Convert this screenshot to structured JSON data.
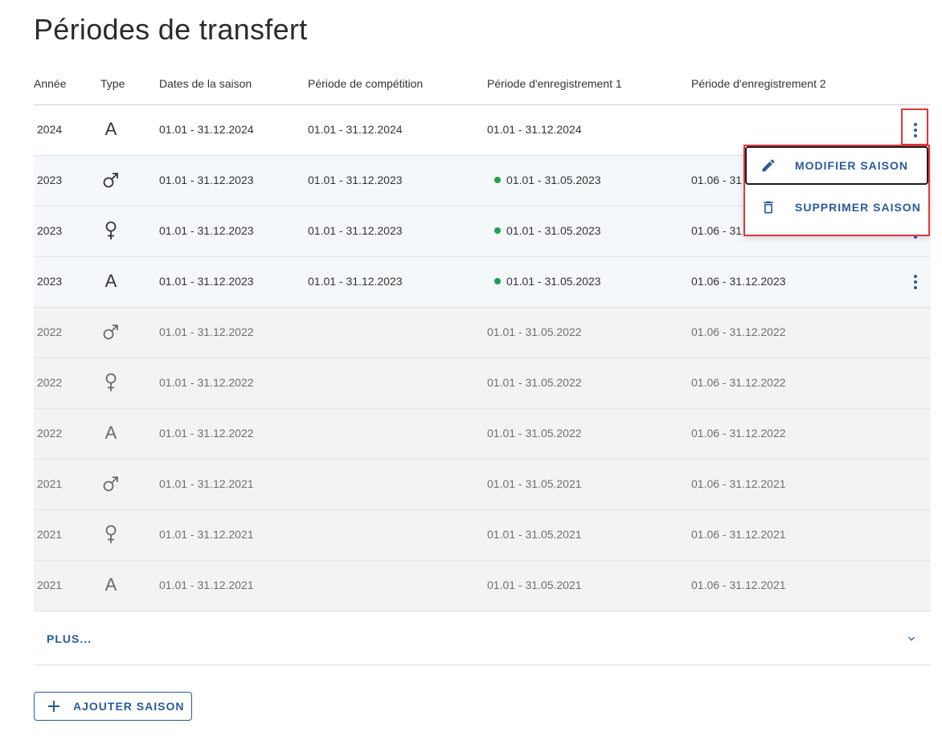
{
  "page": {
    "title": "Périodes de transfert"
  },
  "table": {
    "headers": {
      "year": "Année",
      "type": "Type",
      "season_dates": "Dates de la saison",
      "competition_period": "Période de compétition",
      "registration_period_1": "Période d'enregistrement 1",
      "registration_period_2": "Période d'enregistrement 2"
    },
    "rows": [
      {
        "year": "2024",
        "type": "A",
        "season_dates": "01.01 - 31.12.2024",
        "competition_period": "01.01 - 31.12.2024",
        "registration_period_1": "01.01 - 31.12.2024",
        "registration_period_2": ""
      },
      {
        "year": "2023",
        "type": "male",
        "season_dates": "01.01 - 31.12.2023",
        "competition_period": "01.01 - 31.12.2023",
        "registration_period_1": "01.01 - 31.05.2023",
        "registration_period_2": "01.06 - 31"
      },
      {
        "year": "2023",
        "type": "female",
        "season_dates": "01.01 - 31.12.2023",
        "competition_period": "01.01 - 31.12.2023",
        "registration_period_1": "01.01 - 31.05.2023",
        "registration_period_2": "01.06 - 31"
      },
      {
        "year": "2023",
        "type": "A",
        "season_dates": "01.01 - 31.12.2023",
        "competition_period": "01.01 - 31.12.2023",
        "registration_period_1": "01.01 - 31.05.2023",
        "registration_period_2": "01.06 - 31.12.2023"
      },
      {
        "year": "2022",
        "type": "male",
        "season_dates": "01.01 - 31.12.2022",
        "competition_period": "",
        "registration_period_1": "01.01 - 31.05.2022",
        "registration_period_2": "01.06 - 31.12.2022"
      },
      {
        "year": "2022",
        "type": "female",
        "season_dates": "01.01 - 31.12.2022",
        "competition_period": "",
        "registration_period_1": "01.01 - 31.05.2022",
        "registration_period_2": "01.06 - 31.12.2022"
      },
      {
        "year": "2022",
        "type": "A",
        "season_dates": "01.01 - 31.12.2022",
        "competition_period": "",
        "registration_period_1": "01.01 - 31.05.2022",
        "registration_period_2": "01.06 - 31.12.2022"
      },
      {
        "year": "2021",
        "type": "male",
        "season_dates": "01.01 - 31.12.2021",
        "competition_period": "",
        "registration_period_1": "01.01 - 31.05.2021",
        "registration_period_2": "01.06 - 31.12.2021"
      },
      {
        "year": "2021",
        "type": "female",
        "season_dates": "01.01 - 31.12.2021",
        "competition_period": "",
        "registration_period_1": "01.01 - 31.05.2021",
        "registration_period_2": "01.06 - 31.12.2021"
      },
      {
        "year": "2021",
        "type": "A",
        "season_dates": "01.01 - 31.12.2021",
        "competition_period": "",
        "registration_period_1": "01.01 - 31.05.2021",
        "registration_period_2": "01.06 - 31.12.2021"
      }
    ]
  },
  "context_menu": {
    "edit_label": "MODIFIER SAISON",
    "delete_label": "SUPPRIMER SAISON"
  },
  "more": {
    "label": "PLUS..."
  },
  "actions": {
    "add_season_label": "AJOUTER SAISON"
  },
  "colors": {
    "accent": "#2a5b9a",
    "active_dot": "#1aa34a",
    "highlight": "#e5343c",
    "past_row_bg": "#f3f3f3",
    "active_row_bg": "#f5f8fb"
  },
  "icons": {
    "type_male": "male-symbol-icon",
    "type_female": "female-symbol-icon",
    "edit": "pencil-icon",
    "delete": "trash-icon",
    "more_actions": "more-vertical-icon",
    "expand": "chevron-down-icon",
    "add": "plus-icon"
  }
}
